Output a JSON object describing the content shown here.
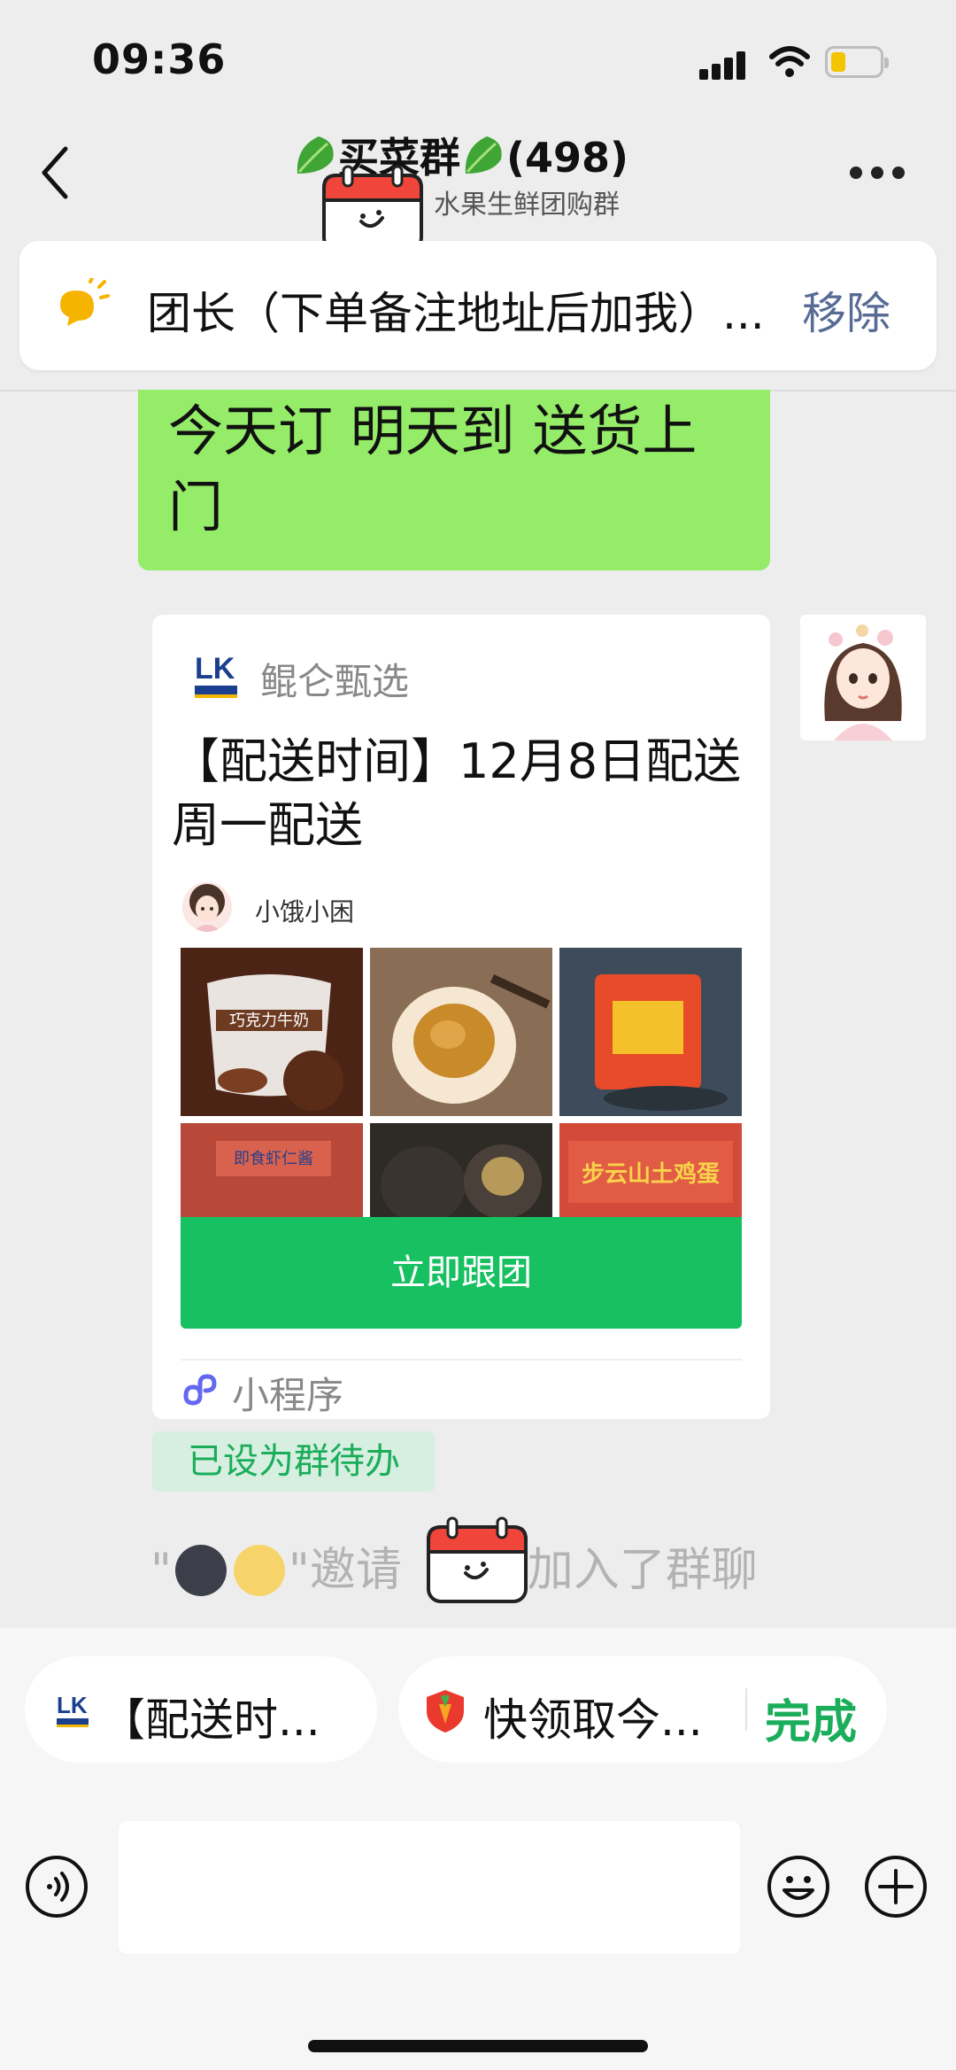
{
  "status_bar": {
    "time": "09:36"
  },
  "nav": {
    "title": "买菜群",
    "count": "(498)",
    "subtitle": "水果生鲜团购群"
  },
  "pinned": {
    "text": "团长（下单备注地址后加我）...",
    "action": "移除"
  },
  "messages": {
    "green_bubble": "今天订 明天到 送货上门",
    "card": {
      "brand": "鲲仑甄选",
      "logo_text": "LK",
      "title": "【配送时间】12月8日配送 周一配送",
      "user": "小饿小困",
      "product_texts": [
        "巧克力牛奶",
        "即食虾仁酱",
        "步云山土鸡蛋"
      ],
      "button": "立即跟团",
      "footer_label": "小程序"
    },
    "todo_badge": "已设为群待办",
    "system": {
      "prefix": "\"",
      "middle": "\"邀请",
      "hidden_name": "",
      "suffix": "\"加入了群聊"
    }
  },
  "bottom": {
    "chip1": "【配送时...",
    "chip2": "快领取今...",
    "chip2_action": "完成"
  },
  "colors": {
    "bubble_green": "#95ec69",
    "wechat_green": "#17c060",
    "link_blue": "#576b95"
  }
}
